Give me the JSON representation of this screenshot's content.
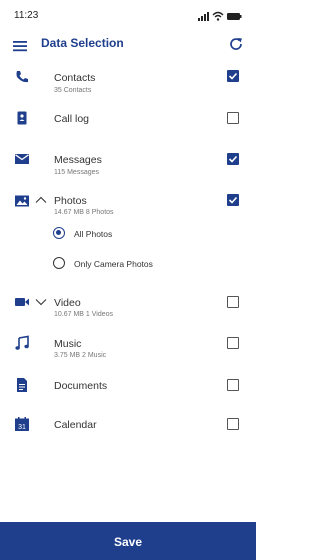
{
  "status": {
    "time": "11:23"
  },
  "header": {
    "title": "Data Selection",
    "menu_icon": "menu-icon",
    "refresh_icon": "refresh-icon"
  },
  "accent_color": "#1f3e8c",
  "items": [
    {
      "name": "contacts",
      "icon": "phone-icon",
      "title": "Contacts",
      "subtitle": "35 Contacts",
      "checked": true
    },
    {
      "name": "call-log",
      "icon": "call-log-icon",
      "title": "Call log",
      "subtitle": "",
      "checked": false
    },
    {
      "name": "messages",
      "icon": "envelope-icon",
      "title": "Messages",
      "subtitle": "115 Messages",
      "checked": true
    },
    {
      "name": "photos",
      "icon": "image-icon",
      "title": "Photos",
      "subtitle": "14.67 MB   8 Photos",
      "checked": true,
      "expanded": true
    },
    {
      "name": "video",
      "icon": "video-camera-icon",
      "title": "Video",
      "subtitle": "10.67 MB   1 Videos",
      "checked": false,
      "expanded": false
    },
    {
      "name": "music",
      "icon": "music-note-icon",
      "title": "Music",
      "subtitle": "3.75 MB   2 Music",
      "checked": false
    },
    {
      "name": "documents",
      "icon": "document-icon",
      "title": "Documents",
      "subtitle": "",
      "checked": false
    },
    {
      "name": "calendar",
      "icon": "calendar-icon",
      "title": "Calendar",
      "subtitle": "",
      "checked": false
    }
  ],
  "photos_options": [
    {
      "label": "All Photos",
      "selected": true
    },
    {
      "label": "Only Camera Photos",
      "selected": false
    }
  ],
  "calendar_icon_day": "31",
  "save_label": "Save"
}
